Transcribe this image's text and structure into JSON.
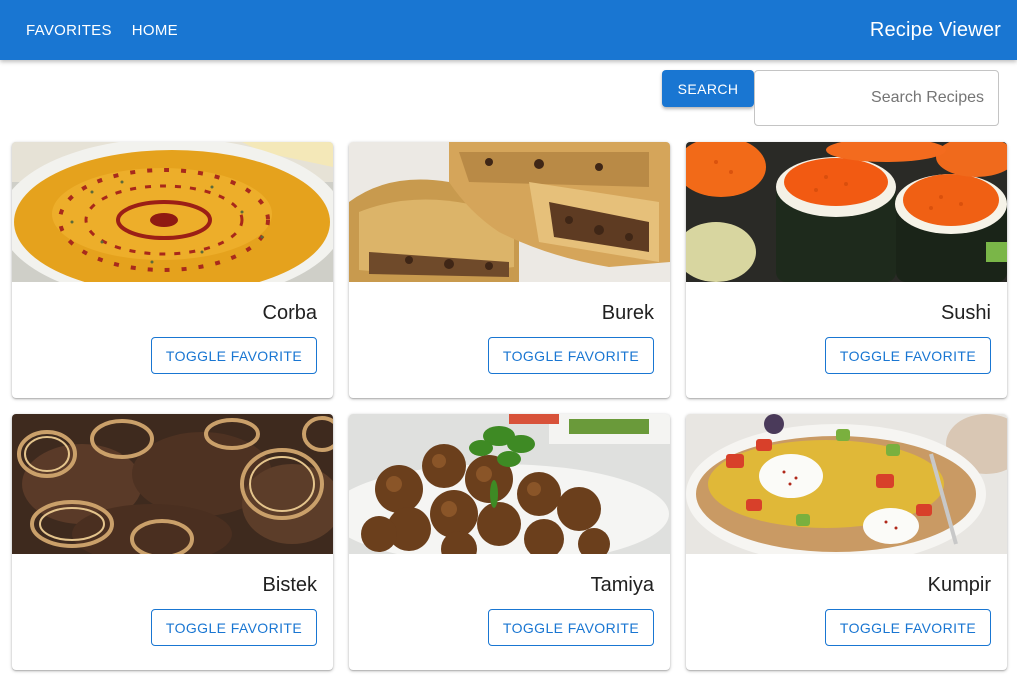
{
  "header": {
    "nav": [
      "FAVORITES",
      "HOME"
    ],
    "title": "Recipe Viewer",
    "brand_color": "#1976d2"
  },
  "search": {
    "button_label": "SEARCH",
    "placeholder": "Search Recipes",
    "value": ""
  },
  "recipes": [
    {
      "name": "Corba",
      "button_label": "TOGGLE FAVORITE",
      "image": "lentil soup in white bowl"
    },
    {
      "name": "Burek",
      "button_label": "TOGGLE FAVORITE",
      "image": "meat-filled pastry slices"
    },
    {
      "name": "Sushi",
      "button_label": "TOGGLE FAVORITE",
      "image": "sushi rolls topped with roe"
    },
    {
      "name": "Bistek",
      "button_label": "TOGGLE FAVORITE",
      "image": "beef steak with onion rings"
    },
    {
      "name": "Tamiya",
      "button_label": "TOGGLE FAVORITE",
      "image": "falafel balls with parsley"
    },
    {
      "name": "Kumpir",
      "button_label": "TOGGLE FAVORITE",
      "image": "stuffed baked potato"
    }
  ]
}
